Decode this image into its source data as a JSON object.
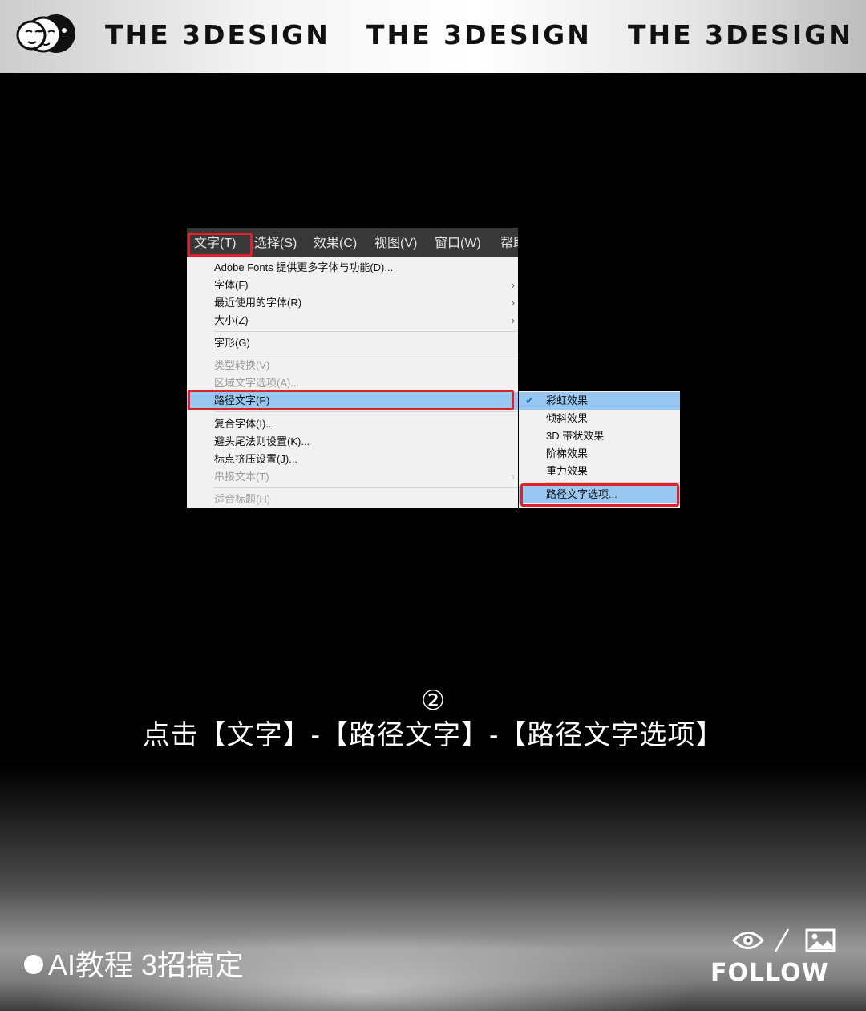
{
  "header": {
    "brand_1": "THE 3DESIGN",
    "brand_2": "THE 3DESIGN",
    "brand_3": "THE 3DESIGN"
  },
  "menubar": {
    "items": [
      "文字(T)",
      "选择(S)",
      "效果(C)",
      "视图(V)",
      "窗口(W)",
      "帮助"
    ]
  },
  "dropdown": {
    "items": [
      {
        "label": "Adobe Fonts 提供更多字体与功能(D)...",
        "submenu": false,
        "disabled": false
      },
      {
        "label": "字体(F)",
        "submenu": true,
        "disabled": false
      },
      {
        "label": "最近使用的字体(R)",
        "submenu": true,
        "disabled": false
      },
      {
        "label": "大小(Z)",
        "submenu": true,
        "disabled": false
      },
      {
        "label": "字形(G)",
        "submenu": false,
        "disabled": false
      },
      {
        "label": "类型转换(V)",
        "submenu": false,
        "disabled": true
      },
      {
        "label": "区域文字选项(A)...",
        "submenu": false,
        "disabled": true
      },
      {
        "label": "路径文字(P)",
        "submenu": true,
        "disabled": false,
        "highlighted": true
      },
      {
        "label": "复合字体(I)...",
        "submenu": false,
        "disabled": false
      },
      {
        "label": "避头尾法则设置(K)...",
        "submenu": false,
        "disabled": false
      },
      {
        "label": "标点挤压设置(J)...",
        "submenu": false,
        "disabled": false
      },
      {
        "label": "串接文本(T)",
        "submenu": true,
        "disabled": true
      },
      {
        "label": "适合标题(H)",
        "submenu": false,
        "disabled": true
      }
    ]
  },
  "submenu": {
    "items": [
      {
        "label": "彩虹效果",
        "checked": true
      },
      {
        "label": "倾斜效果",
        "checked": false
      },
      {
        "label": "3D 带状效果",
        "checked": false
      },
      {
        "label": "阶梯效果",
        "checked": false
      },
      {
        "label": "重力效果",
        "checked": false
      },
      {
        "label": "路径文字选项...",
        "checked": false,
        "highlighted": true
      }
    ]
  },
  "caption": {
    "step": "②",
    "text": "点击【文字】-【路径文字】-【路径文字选项】"
  },
  "footer": {
    "tag": "AI教程 3招搞定",
    "follow": "FOLLOW",
    "icons": [
      "eye-icon",
      "slash-icon",
      "image-icon"
    ]
  },
  "colors": {
    "highlight": "#98c7f2",
    "red_box": "#e0202a",
    "menubar": "#383838",
    "menu_bg": "#f1f1f1"
  }
}
